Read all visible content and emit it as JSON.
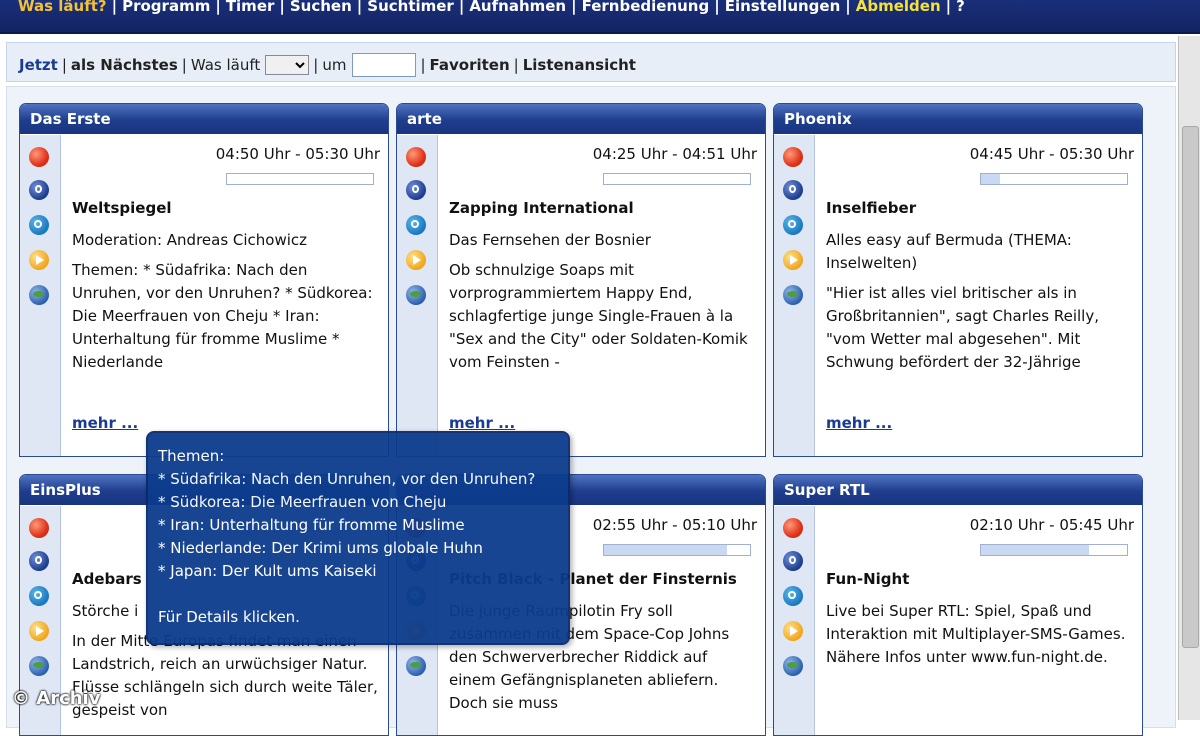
{
  "topnav": {
    "items": [
      "Was läuft?",
      "Programm",
      "Timer",
      "Suchen",
      "Suchtimer",
      "Aufnahmen",
      "Fernbedienung",
      "Einstellungen",
      "Abmelden",
      "?"
    ]
  },
  "subnav": {
    "now": "Jetzt",
    "next": "als Nächstes",
    "whats_on": "Was läuft",
    "at": "um",
    "time_value": "",
    "favorites": "Favoriten",
    "list_view": "Listenansicht"
  },
  "icons": [
    "record-icon",
    "timer-icon",
    "search-icon",
    "play-icon",
    "web-icon"
  ],
  "channels": [
    {
      "name": "Das Erste",
      "time": "04:50 Uhr - 05:30 Uhr",
      "progress": 0.0,
      "title": "Weltspiegel",
      "subtitle": "Moderation: Andreas Cichowicz",
      "desc": "Themen: * Südafrika: Nach den Unruhen, vor den Unruhen? * Südkorea: Die Meerfrauen von Cheju * Iran: Unterhaltung für fromme Muslime * Niederlande",
      "more": "mehr ..."
    },
    {
      "name": "arte",
      "time": "04:25 Uhr - 04:51 Uhr",
      "progress": 0.0,
      "title": "Zapping International",
      "subtitle": "Das Fernsehen der Bosnier",
      "desc": "Ob schnulzige Soaps mit vorprogrammiertem Happy End, schlagfertige junge Single-Frauen à la \"Sex and the City\" oder Soldaten-Komik vom Feinsten -",
      "more": "mehr ..."
    },
    {
      "name": "Phoenix",
      "time": "04:45 Uhr - 05:30 Uhr",
      "progress": 0.13,
      "title": "Inselfieber",
      "subtitle": "Alles easy auf Bermuda (THEMA: Inselwelten)",
      "desc": "\"Hier ist alles viel britischer als in Großbritannien\", sagt Charles Reilly, \"vom Wetter mal abgesehen\". Mit Schwung befördert der 32-Jährige",
      "more": "mehr ..."
    },
    {
      "name": "EinsPlus",
      "title": "Adebars",
      "subtitle": "Störche i",
      "desc": "In der Mitte Europas findet man einen Landstrich, reich an urwüchsiger Natur. Flüsse schlängeln sich durch weite Täler, gespeist von"
    },
    {
      "name": "",
      "time": "02:55 Uhr - 05:10 Uhr",
      "progress": 0.84,
      "title": "Pitch Black - Planet der Finsternis",
      "subtitle": "Die junge Raumpilotin Fry soll zusammen mit dem Space-Cop Johns den Schwerverbrecher Riddick auf einem Gefängnisplaneten abliefern. Doch sie muss"
    },
    {
      "name": "Super RTL",
      "time": "02:10 Uhr - 05:45 Uhr",
      "progress": 0.74,
      "title": "Fun-Night",
      "subtitle": "Live bei Super RTL: Spiel, Spaß und Interaktion mit Multiplayer-SMS-Games. Nähere Infos unter www.fun-night.de."
    }
  ],
  "tooltip": {
    "heading": "Themen:",
    "lines": [
      "* Südafrika: Nach den Unruhen, vor den Unruhen?",
      "* Südkorea: Die Meerfrauen von Cheju",
      "* Iran: Unterhaltung für fromme Muslime",
      "* Niederlande: Der Krimi ums globale Huhn",
      "* Japan: Der Kult ums Kaiseki"
    ],
    "footer": "Für Details klicken."
  },
  "watermark": "© Archiv"
}
